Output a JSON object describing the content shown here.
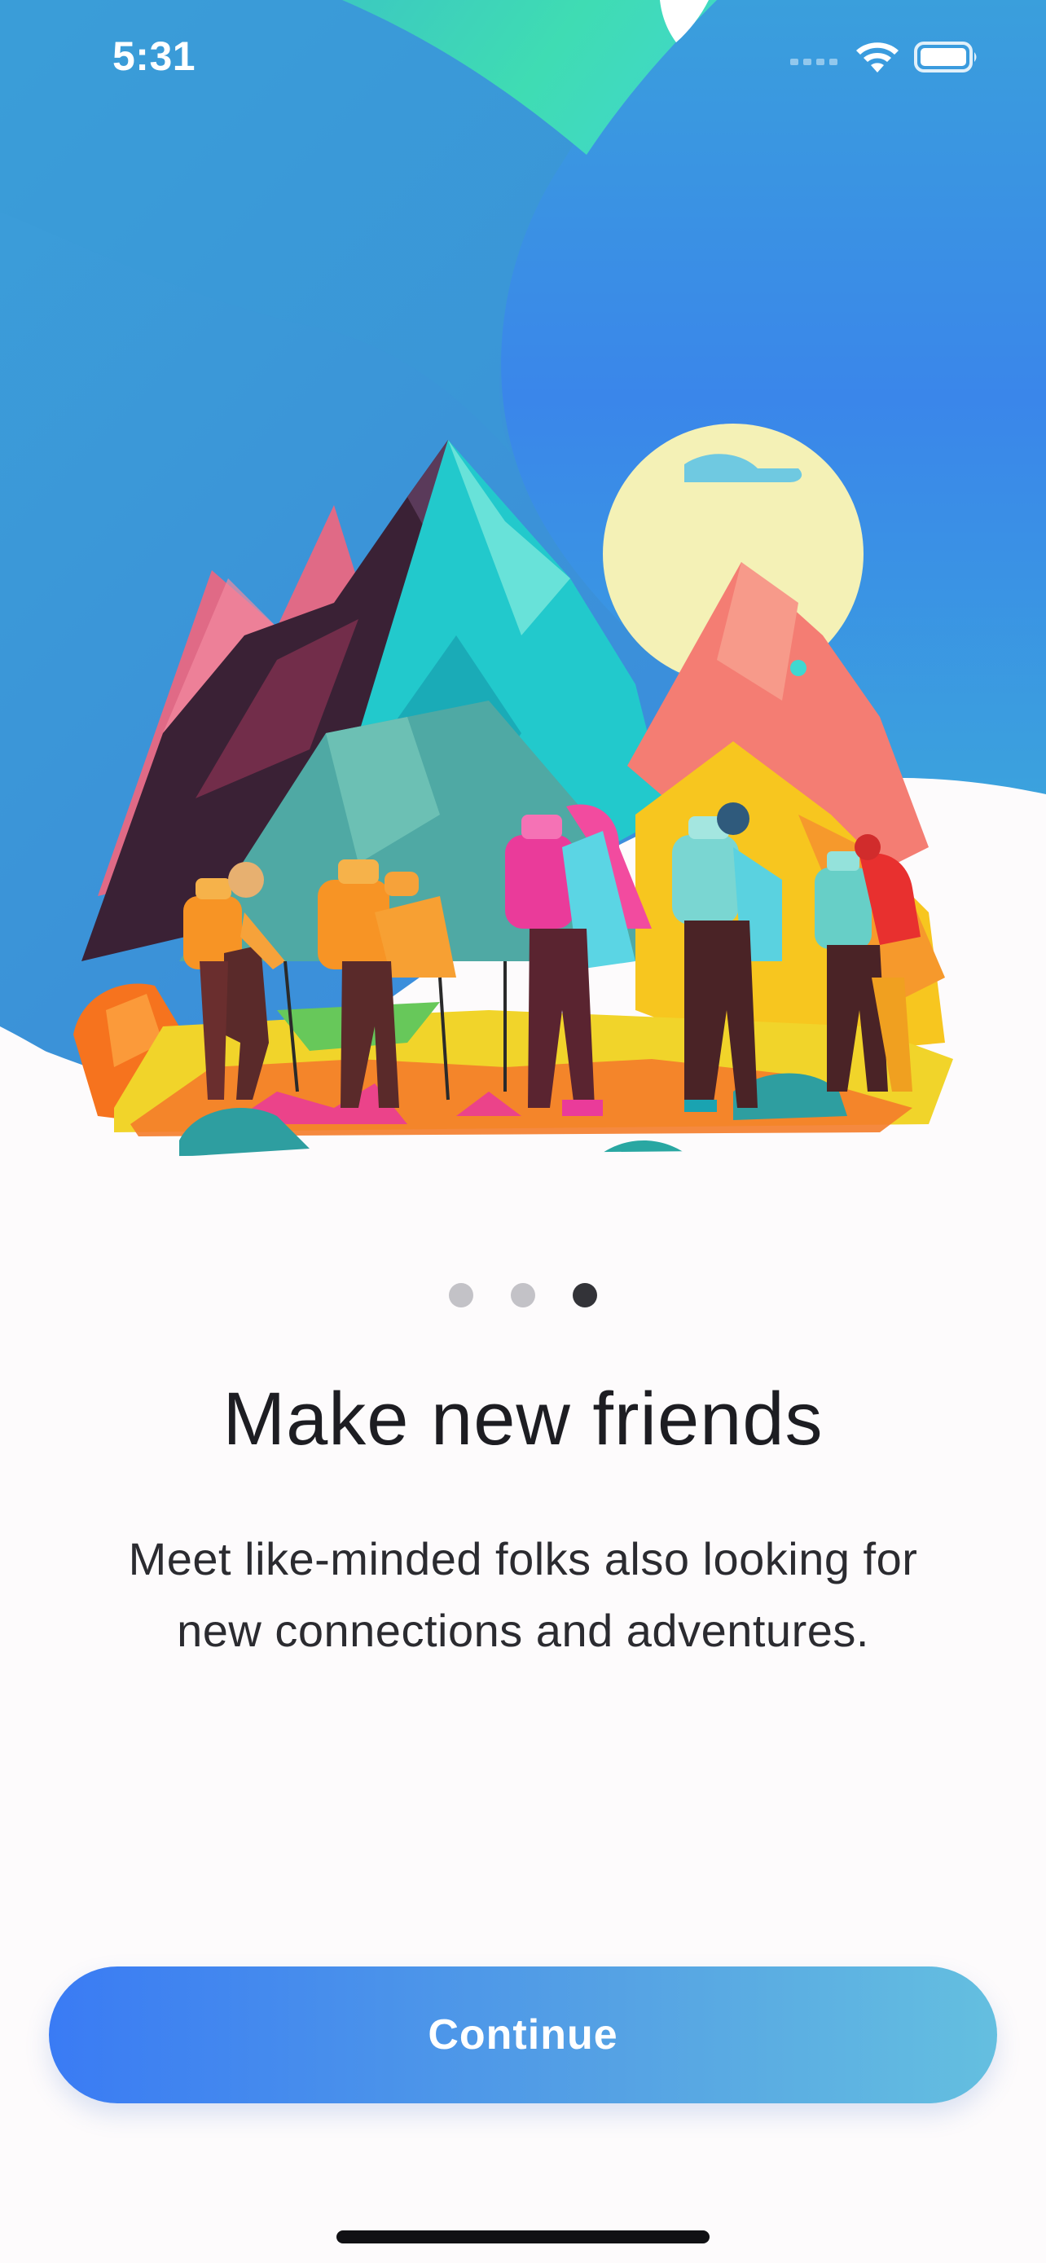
{
  "status_bar": {
    "time": "5:31",
    "icons": [
      "cellular-signal-icon",
      "wifi-icon",
      "battery-icon"
    ]
  },
  "hero": {
    "illustration": "hikers-mountain-illustration"
  },
  "pager": {
    "total": 3,
    "active_index": 2
  },
  "content": {
    "title": "Make new friends",
    "subtitle_line1": "Meet like-minded folks also looking for",
    "subtitle_line2": "new connections and adventures."
  },
  "actions": {
    "continue_label": "Continue"
  },
  "colors": {
    "accent_start": "#3a7bf4",
    "accent_end": "#64bfe0",
    "hero_blue": "#3b92d8",
    "hero_teal": "#3fd3b5",
    "background": "#fdfbfc",
    "text": "#1d1d22"
  }
}
